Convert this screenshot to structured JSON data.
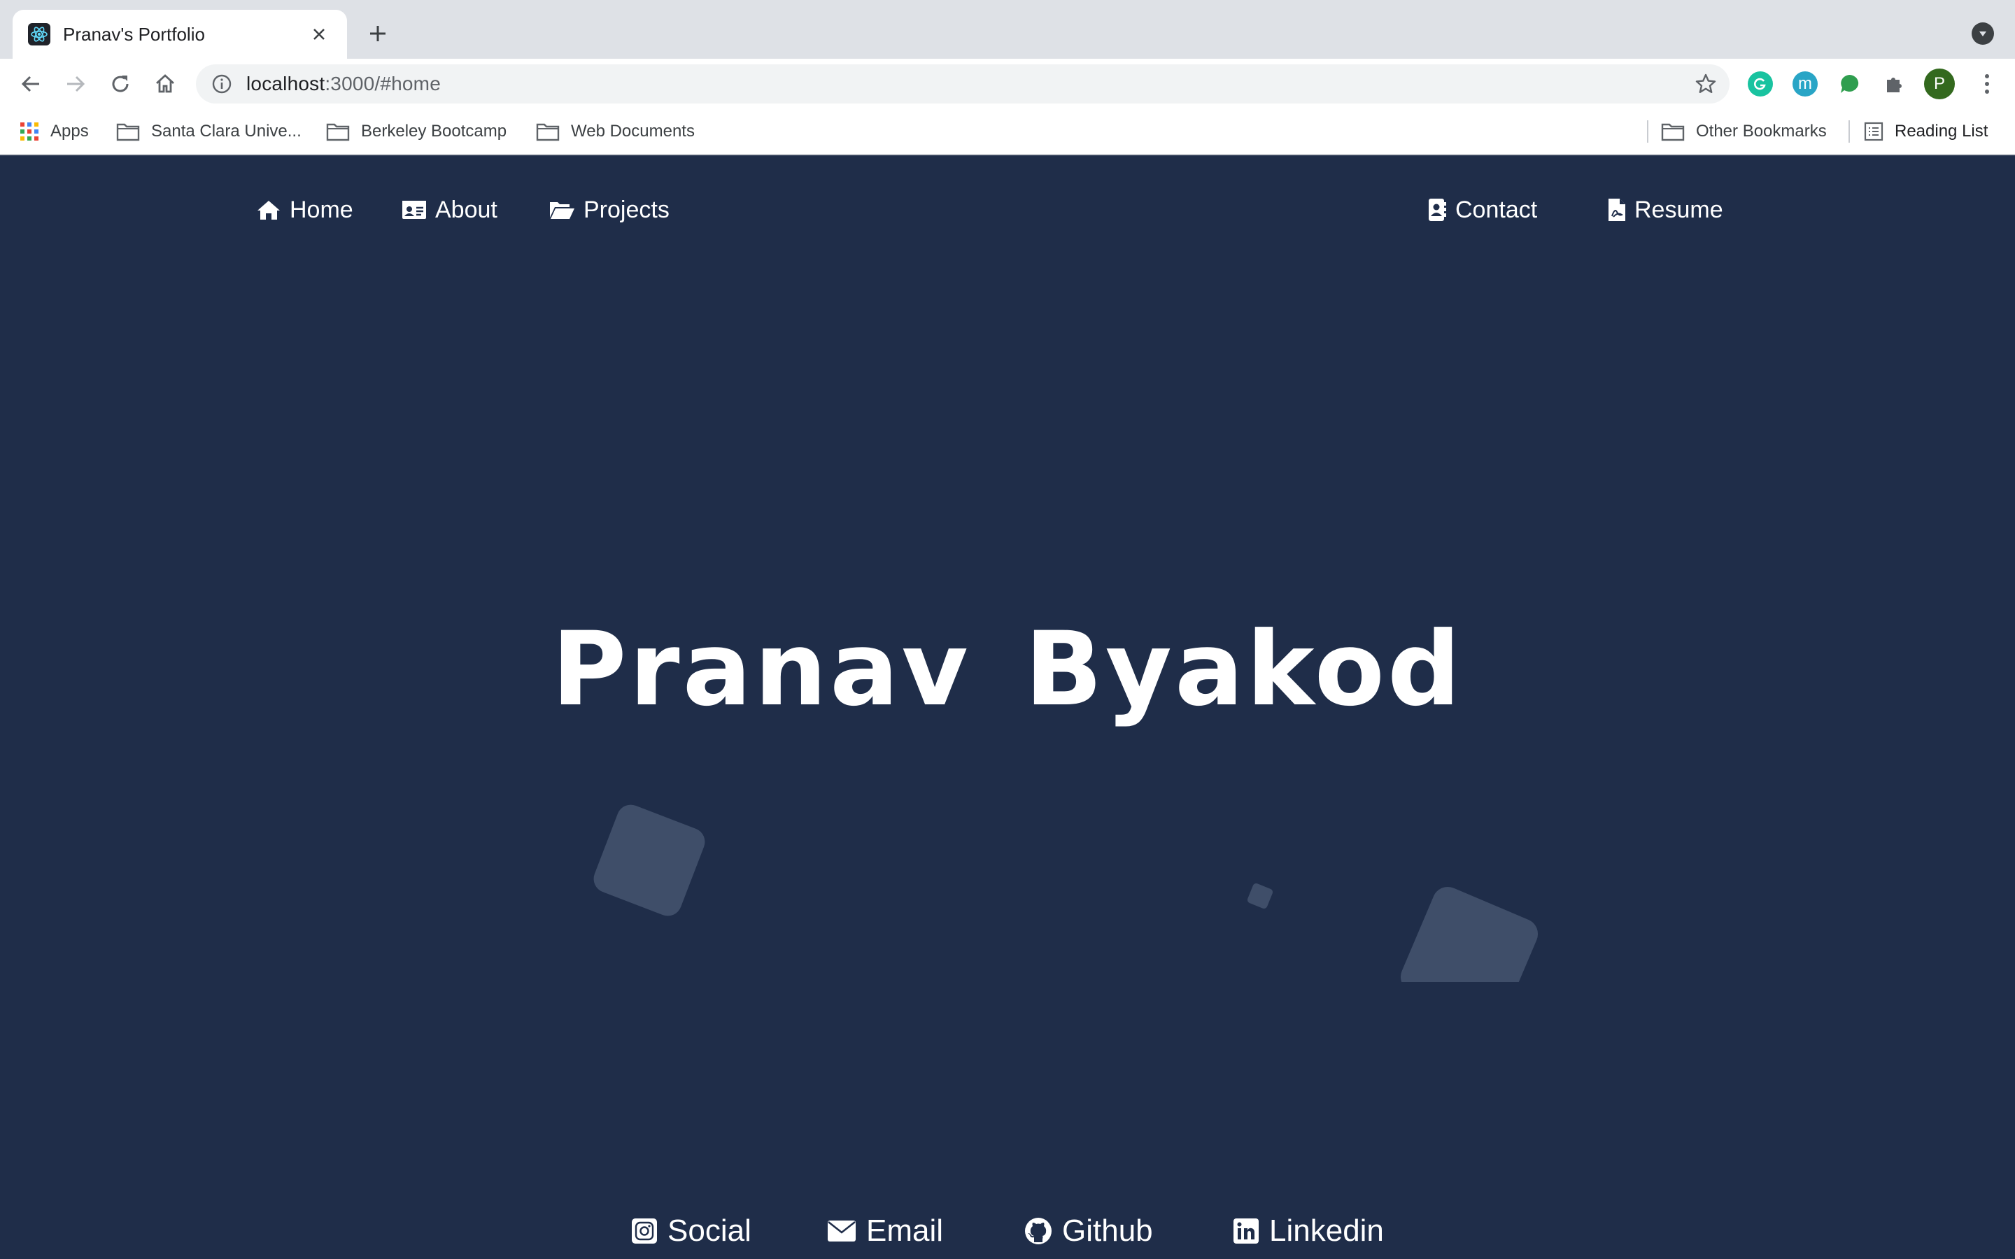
{
  "browser": {
    "tab_title": "Pranav's Portfolio",
    "url_host": "localhost",
    "url_path": ":3000/#home",
    "profile_initial": "P",
    "extension_m_label": "m"
  },
  "bookmarks": {
    "apps": "Apps",
    "items": [
      "Santa Clara Unive...",
      "Berkeley Bootcamp",
      "Web Documents"
    ],
    "other": "Other Bookmarks",
    "reading_list": "Reading List"
  },
  "nav": {
    "home": "Home",
    "about": "About",
    "projects": "Projects",
    "contact": "Contact",
    "resume": "Resume"
  },
  "hero": {
    "name": "Pranav Byakod"
  },
  "footer": {
    "social": "Social",
    "email": "Email",
    "github": "Github",
    "linkedin": "Linkedin"
  },
  "colors": {
    "page_background": "#1f2d49",
    "shape": "#3f4e69",
    "text": "#ffffff"
  }
}
